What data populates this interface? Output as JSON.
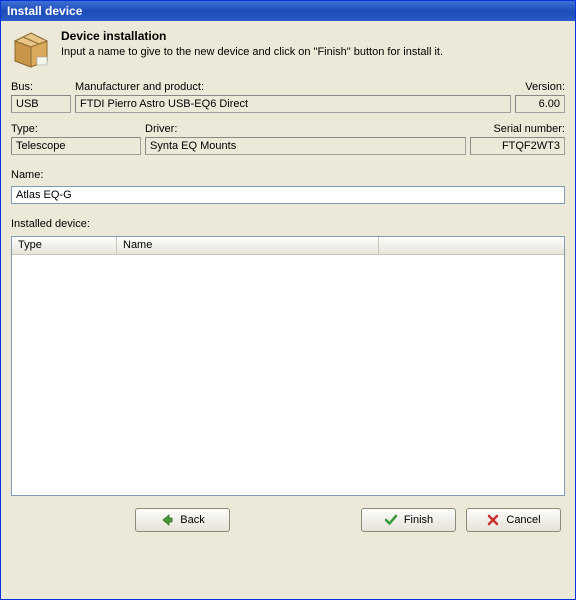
{
  "window": {
    "title": "Install device"
  },
  "header": {
    "title": "Device installation",
    "subtitle": "Input a name to give to the new device and click on \"Finish\" button for install it."
  },
  "labels": {
    "bus": "Bus:",
    "manufacturer": "Manufacturer and product:",
    "version": "Version:",
    "type": "Type:",
    "driver": "Driver:",
    "serial": "Serial number:",
    "name": "Name:",
    "installed": "Installed device:"
  },
  "fields": {
    "bus": "USB",
    "manufacturer": "FTDI Pierro Astro USB-EQ6 Direct",
    "version": "6.00",
    "type": "Telescope",
    "driver": "Synta EQ Mounts",
    "serial": "FTQF2WT3",
    "name": "Atlas EQ-G"
  },
  "table": {
    "columns": {
      "type": "Type",
      "name": "Name",
      "extra": ""
    },
    "rows": []
  },
  "buttons": {
    "back": "Back",
    "finish": "Finish",
    "cancel": "Cancel"
  }
}
